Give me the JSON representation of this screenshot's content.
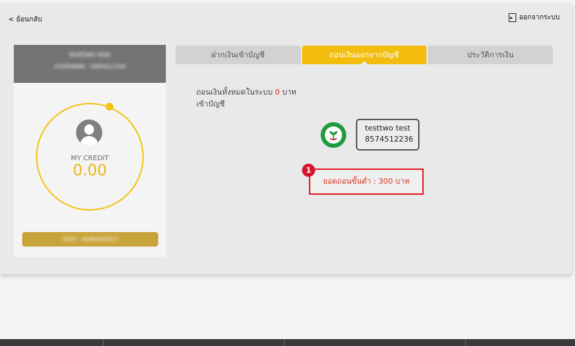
{
  "nav": {
    "back_label": "< ย้อนกลับ",
    "logout_label": "ออกจากระบบ"
  },
  "profile": {
    "name": "testtwo test",
    "username": "USERNAME : 0985612344",
    "credit_label": "MY CREDIT",
    "credit_value": "0.00",
    "user_id": "USER : AUN0000012"
  },
  "tabs": [
    {
      "label": "ฝากเงินเข้าบัญชี",
      "active": false
    },
    {
      "label": "ถอนเงินออกจากบัญชี",
      "active": true
    },
    {
      "label": "ประวัติการเงิน",
      "active": false
    }
  ],
  "withdraw": {
    "summary_prefix": "ถอนเงินทั้งหมดในระบบ",
    "summary_amount": "0",
    "summary_suffix": "บาท",
    "summary_line2": "เข้าบัญชี",
    "account_name": "testtwo test",
    "account_number": "8574512236",
    "step_number": "1",
    "minimum_text": "ยอดถอนขั้นต่ำ : 300 บาท"
  },
  "colors": {
    "accent": "#f2bd0d",
    "alert": "#e21a22",
    "bank": "#1f9a3d"
  }
}
